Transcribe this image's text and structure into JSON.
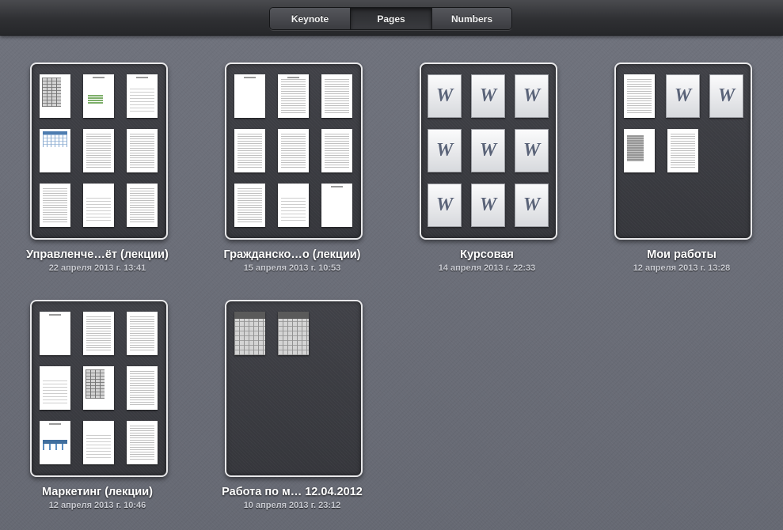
{
  "tabs": {
    "keynote": "Keynote",
    "pages": "Pages",
    "numbers": "Numbers",
    "active": "pages"
  },
  "folders": [
    {
      "title": "Управленче…ёт (лекции)",
      "date": "22 апреля 2013 г. 13:41",
      "document_count": 9
    },
    {
      "title": "Гражданско…о (лекции)",
      "date": "15 апреля 2013 г. 10:53",
      "document_count": 9
    },
    {
      "title": "Курсовая",
      "date": "14 апреля 2013 г. 22:33",
      "document_count": 9,
      "icon": "word-document-icon"
    },
    {
      "title": "Мои работы",
      "date": "12 апреля 2013 г. 13:28",
      "document_count": 5
    },
    {
      "title": "Маркетинг (лекции)",
      "date": "12 апреля 2013 г. 10:46",
      "document_count": 9
    },
    {
      "title": "Работа по м… 12.04.2012",
      "date": "10 апреля 2013 г. 23:12",
      "document_count": 2
    }
  ],
  "icons": {
    "word_glyph": "W"
  },
  "colors": {
    "background": "#6b6e78",
    "toolbar": "#2f3033",
    "folder_border": "#e8e8ea",
    "title_text": "#ffffff",
    "date_text": "#c9cbd2"
  }
}
